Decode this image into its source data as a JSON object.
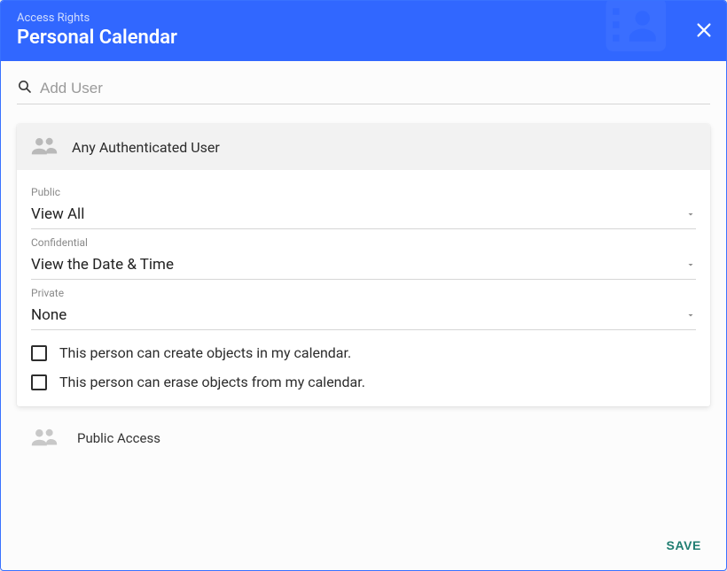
{
  "header": {
    "subtitle": "Access Rights",
    "title": "Personal Calendar"
  },
  "search": {
    "placeholder": "Add User"
  },
  "acl": {
    "authenticated": {
      "label": "Any Authenticated User",
      "public": {
        "label": "Public",
        "value": "View All"
      },
      "confidential": {
        "label": "Confidential",
        "value": "View the Date & Time"
      },
      "private": {
        "label": "Private",
        "value": "None"
      },
      "can_create": "This person can create objects in my calendar.",
      "can_erase": "This person can erase objects from my calendar."
    },
    "public_access": {
      "label": "Public Access"
    }
  },
  "actions": {
    "save": "SAVE"
  }
}
